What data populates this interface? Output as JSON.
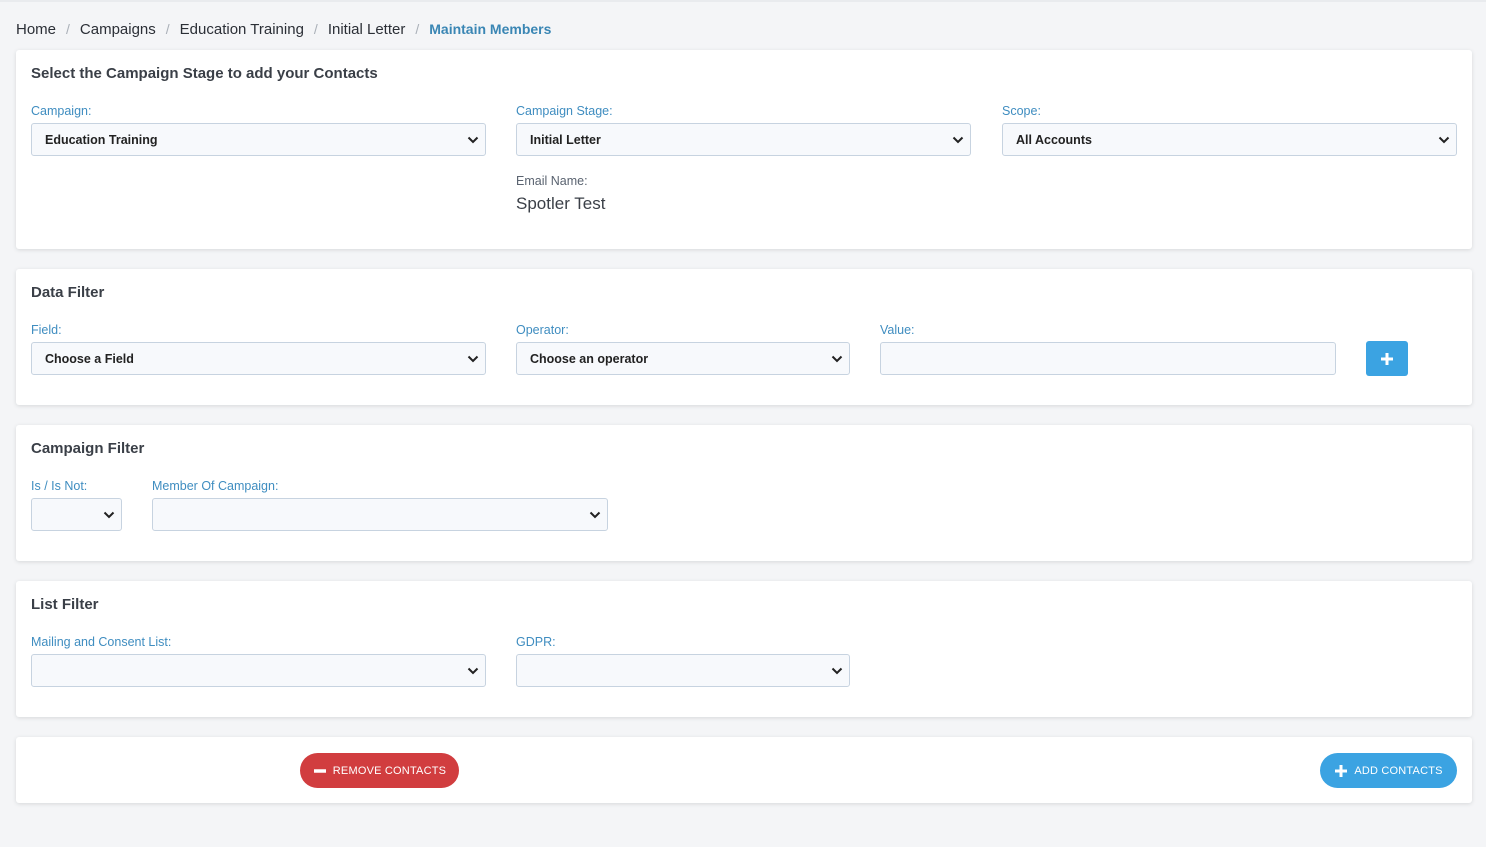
{
  "breadcrumb": {
    "items": [
      "Home",
      "Campaigns",
      "Education Training",
      "Initial Letter"
    ],
    "current": "Maintain Members"
  },
  "campaign_stage": {
    "title": "Select the Campaign Stage to add your Contacts",
    "campaign_label": "Campaign:",
    "campaign_value": "Education Training",
    "stage_label": "Campaign Stage:",
    "stage_value": "Initial Letter",
    "scope_label": "Scope:",
    "scope_value": "All Accounts",
    "email_name_label": "Email Name:",
    "email_name_value": "Spotler Test"
  },
  "data_filter": {
    "title": "Data Filter",
    "field_label": "Field:",
    "field_value": "Choose a Field",
    "operator_label": "Operator:",
    "operator_value": "Choose an operator",
    "value_label": "Value:",
    "value": ""
  },
  "campaign_filter": {
    "title": "Campaign Filter",
    "is_not_label": "Is / Is Not:",
    "is_not_value": "",
    "member_label": "Member Of Campaign:",
    "member_value": ""
  },
  "list_filter": {
    "title": "List Filter",
    "mailing_label": "Mailing and Consent List:",
    "mailing_value": "",
    "gdpr_label": "GDPR:",
    "gdpr_value": ""
  },
  "actions": {
    "remove_label": "REMOVE CONTACTS",
    "add_label": "ADD CONTACTS"
  },
  "colors": {
    "accent": "#3ba3e2",
    "danger": "#d13d3f",
    "label": "#3f8dc0"
  },
  "icons": [
    "chevron-down-icon",
    "plus-icon",
    "minus-icon"
  ]
}
